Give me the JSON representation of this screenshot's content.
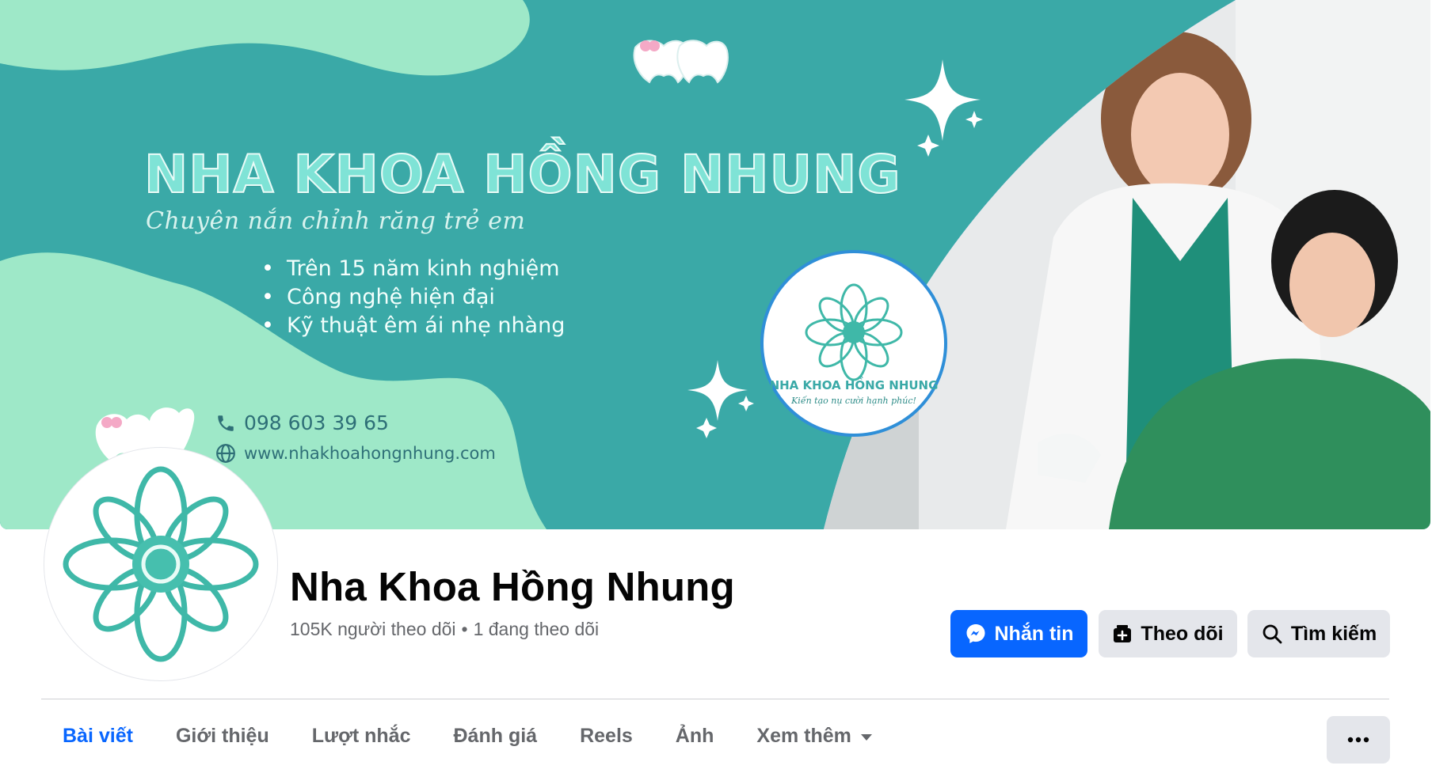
{
  "cover": {
    "brand_title": "NHA KHOA HỒNG NHUNG",
    "tagline": "Chuyên nắn chỉnh răng trẻ em",
    "features": [
      "Trên 15 năm kinh nghiệm",
      "Công nghệ hiện đại",
      "Kỹ thuật êm ái nhẹ nhàng"
    ],
    "phone": "098 603 39 65",
    "website": "www.nhakhoahongnhung.com",
    "logo_name": "NHA KHOA HỒNG NHUNG",
    "logo_slogan": "Kiến tạo nụ cười hạnh phúc!",
    "colors": {
      "teal": "#3aa9a7",
      "mint": "#9ee8c8",
      "logo_ring": "#2f8fd8"
    }
  },
  "profile": {
    "name": "Nha Khoa Hồng Nhung",
    "followers": "105K người theo dõi",
    "separator": "•",
    "following": "1 đang theo dõi"
  },
  "actions": {
    "message_label": "Nhắn tin",
    "follow_label": "Theo dõi",
    "search_label": "Tìm kiếm",
    "message_icon": "messenger-icon",
    "follow_icon": "follow-icon",
    "search_icon": "search-icon",
    "primary_color": "#0866ff"
  },
  "tabs": [
    {
      "label": "Bài viết",
      "active": true
    },
    {
      "label": "Giới thiệu",
      "active": false
    },
    {
      "label": "Lượt nhắc",
      "active": false
    },
    {
      "label": "Đánh giá",
      "active": false
    },
    {
      "label": "Reels",
      "active": false
    },
    {
      "label": "Ảnh",
      "active": false
    },
    {
      "label": "Xem thêm",
      "active": false,
      "dropdown": true
    }
  ],
  "more_options_icon": "more-dots-icon"
}
